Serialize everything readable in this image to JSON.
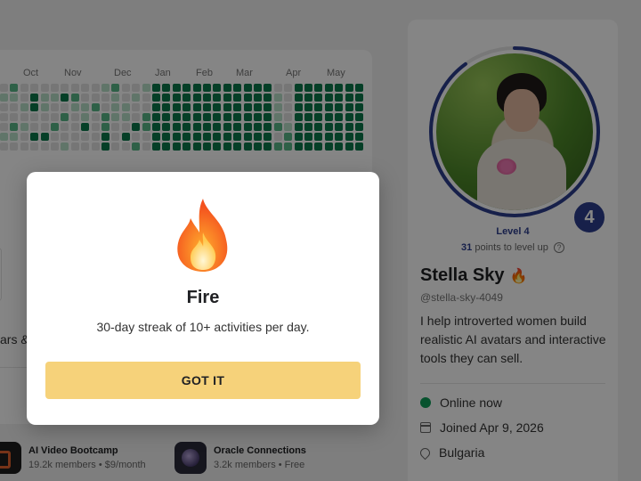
{
  "activity": {
    "months": [
      "Oct",
      "Nov",
      "Dec",
      "Jan",
      "Feb",
      "Mar",
      "Apr",
      "May"
    ]
  },
  "left_panel": {
    "truncated_text": "ars &"
  },
  "groups": [
    {
      "name": "AI Video Bootcamp",
      "meta": "19.2k members • $9/month"
    },
    {
      "name": "Oracle Connections",
      "meta": "3.2k members • Free"
    }
  ],
  "profile": {
    "level_number": "4",
    "level_label": "Level 4",
    "points_to_level_up": "31",
    "points_suffix": "points to level up",
    "help_glyph": "?",
    "name": "Stella Sky",
    "name_badge": "🔥",
    "handle": "@stella-sky-4049",
    "bio": "I help introverted women build realistic AI avatars and interactive tools they can sell.",
    "status": "Online now",
    "joined": "Joined Apr 9, 2026",
    "location": "Bulgaria",
    "level_progress_fraction": 0.9
  },
  "modal": {
    "icon": "fire-icon",
    "title": "Fire",
    "description": "30-day streak of 10+ activities per day.",
    "button_label": "GOT IT"
  },
  "colors": {
    "accent_blue": "#2c3e8f",
    "button_yellow": "#f6d27a",
    "heatmap_dark": "#0b7a4b",
    "heatmap_mid": "#59b889",
    "heatmap_light": "#b9e0c9",
    "heatmap_empty": "#e3e3e3",
    "online_green": "#0f9d58"
  }
}
